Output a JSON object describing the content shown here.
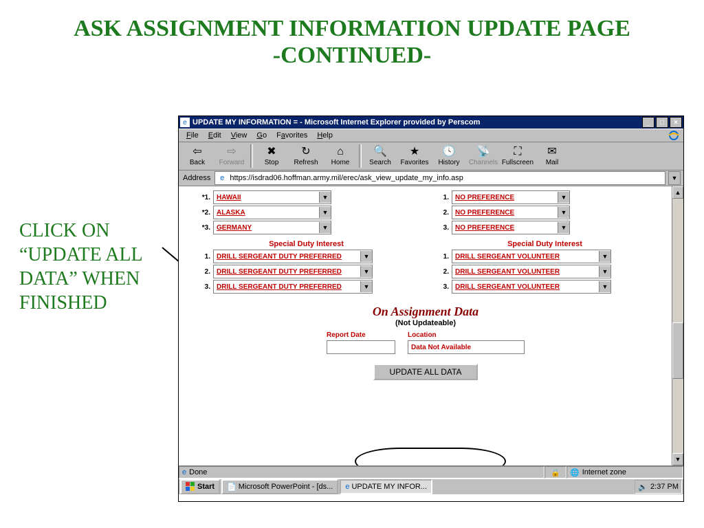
{
  "slide": {
    "title_line1": "ASK ASSIGNMENT INFORMATION UPDATE PAGE",
    "title_line2": "-CONTINUED-",
    "note": "CLICK ON “UPDATE ALL DATA” WHEN FINISHED"
  },
  "window": {
    "title": "UPDATE MY INFORMATION = - Microsoft Internet Explorer provided by Perscom",
    "min": "_",
    "max": "□",
    "close": "×"
  },
  "menu": {
    "file": "File",
    "edit": "Edit",
    "view": "View",
    "go": "Go",
    "favorites": "Favorites",
    "help": "Help"
  },
  "toolbar": {
    "back": "Back",
    "forward": "Forward",
    "stop": "Stop",
    "refresh": "Refresh",
    "home": "Home",
    "search": "Search",
    "favorites": "Favorites",
    "history": "History",
    "channels": "Channels",
    "fullscreen": "Fullscreen",
    "mail": "Mail"
  },
  "address": {
    "label": "Address",
    "url": "https://isdrad06.hoffman.army.mil/erec/ask_view_update_my_info.asp"
  },
  "form": {
    "left_prefs": [
      {
        "num": "*1.",
        "value": "HAWAII"
      },
      {
        "num": "*2.",
        "value": "ALASKA"
      },
      {
        "num": "*3.",
        "value": "GERMANY"
      }
    ],
    "right_prefs": [
      {
        "num": "1.",
        "value": "NO PREFERENCE"
      },
      {
        "num": "2.",
        "value": "NO PREFERENCE"
      },
      {
        "num": "3.",
        "value": "NO PREFERENCE"
      }
    ],
    "sdi_title": "Special Duty Interest",
    "left_sdi": [
      {
        "num": "1.",
        "value": "DRILL SERGEANT DUTY PREFERRED"
      },
      {
        "num": "2.",
        "value": "DRILL SERGEANT DUTY PREFERRED"
      },
      {
        "num": "3.",
        "value": "DRILL SERGEANT DUTY PREFERRED"
      }
    ],
    "right_sdi": [
      {
        "num": "1.",
        "value": "DRILL SERGEANT VOLUNTEER"
      },
      {
        "num": "2.",
        "value": "DRILL SERGEANT VOLUNTEER"
      },
      {
        "num": "3.",
        "value": "DRILL SERGEANT VOLUNTEER"
      }
    ],
    "oad_title": "On Assignment Data",
    "oad_sub": "(Not Updateable)",
    "report_date_label": "Report Date",
    "location_label": "Location",
    "report_date_value": "",
    "location_value": "Data Not Available",
    "update_button": "UPDATE ALL DATA"
  },
  "status": {
    "done": "Done",
    "zone": "Internet zone"
  },
  "taskbar": {
    "start": "Start",
    "app1": "Microsoft PowerPoint - [ds...",
    "app2": "UPDATE MY INFOR...",
    "time": "2:37 PM"
  }
}
